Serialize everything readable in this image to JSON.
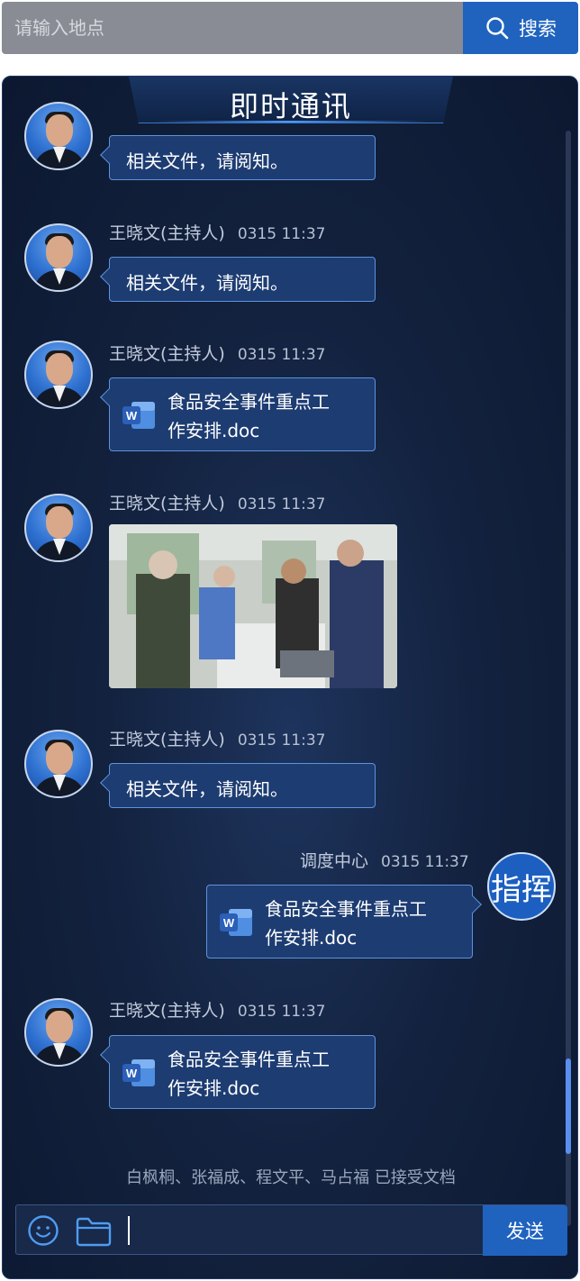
{
  "search": {
    "placeholder": "请输入地点",
    "button_label": "搜索"
  },
  "panel": {
    "title": "即时通讯"
  },
  "messages": [
    {
      "sender": "",
      "time": "",
      "type": "text",
      "text": "相关文件，请阅知。"
    },
    {
      "sender": "王晓文(主持人)",
      "time": "0315 11:37",
      "type": "text",
      "text": "相关文件，请阅知。"
    },
    {
      "sender": "王晓文(主持人)",
      "time": "0315 11:37",
      "type": "file",
      "file_line1": "食品安全事件重点工",
      "file_line2": "作安排.doc"
    },
    {
      "sender": "王晓文(主持人)",
      "time": "0315 11:37",
      "type": "image"
    },
    {
      "sender": "王晓文(主持人)",
      "time": "0315 11:37",
      "type": "text",
      "text": "相关文件，请阅知。"
    },
    {
      "sender": "调度中心",
      "time": "0315 11:37",
      "type": "file",
      "avatar_text": "指挥",
      "file_line1": "食品安全事件重点工",
      "file_line2": "作安排.doc"
    },
    {
      "sender": "王晓文(主持人)",
      "time": "0315 11:37",
      "type": "file",
      "file_line1": "食品安全事件重点工",
      "file_line2": "作安排.doc"
    }
  ],
  "notice": "白枫桐、张福成、程文平、马占福 已接受文档",
  "composer": {
    "send_label": "发送",
    "value": ""
  },
  "colors": {
    "accent": "#1f63bf",
    "panel_bg": "#13223f",
    "bubble_bg": "#1d3c72",
    "bubble_border": "#5d93dc",
    "word_blue": "#2b5fb8"
  }
}
